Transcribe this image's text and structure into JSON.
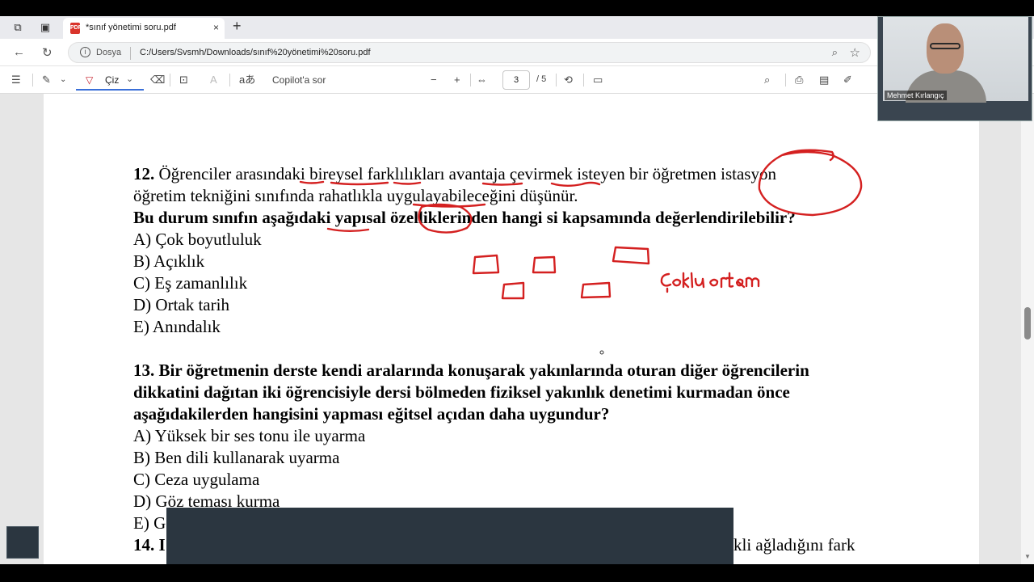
{
  "browser": {
    "tab_title": "*sınıf yönetimi soru.pdf",
    "tab_close": "×",
    "new_tab": "+",
    "address_label": "Dosya",
    "url": "C:/Users/Svsmh/Downloads/sınıf%20yönetimi%20soru.pdf"
  },
  "pdf_toolbar": {
    "draw_label": "Çiz",
    "copilot_label": "Copilot'a sor",
    "zoom_out": "−",
    "zoom_in": "+",
    "current_page": "3",
    "total_pages": "/ 5"
  },
  "document": {
    "q12_number": "12.",
    "q12_line1": " Öğrenciler arasındaki bireysel farklılıkları avantaja çevirmek isteyen bir öğretmen istasyon",
    "q12_line2": "öğretim tekniğini sınıfında rahatlıkla uygulayabileceğini düşünür.",
    "q12_question": "Bu durum sınıfın aşağıdaki yapısal özelliklerinden hangi si kapsamında değerlendirilebilir?",
    "q12_options": [
      "A) Çok boyutluluk",
      "B) Açıklık",
      "C) Eş zamanlılık",
      "D) Ortak tarih",
      "E) Anındalık"
    ],
    "q13_number": "13.",
    "q13_line1": " Bir öğretmenin derste kendi aralarında konuşarak yakınlarında oturan diğer öğrencilerin",
    "q13_line2": "dikkatini dağıtan iki öğrencisiyle dersi bölmeden fiziksel yakınlık denetimi kurmadan önce",
    "q13_line3": "aşağıdakilerden hangisini yapması eğitsel açıdan daha uygundur?",
    "q13_options": [
      "A) Yüksek bir ses tonu ile uyarma",
      "B) Ben dili kullanarak uyarma",
      "C) Ceza uygulama",
      "D) Göz teması kurma",
      "E) G"
    ],
    "q14_partial_left": "14. I",
    "q14_partial_right": "kli ağladığını fark"
  },
  "annotations": {
    "ink_color": "#d42020",
    "handwriting": "Çoklu ortam"
  },
  "webcam": {
    "name": "Mehmet Kırlangıç"
  }
}
